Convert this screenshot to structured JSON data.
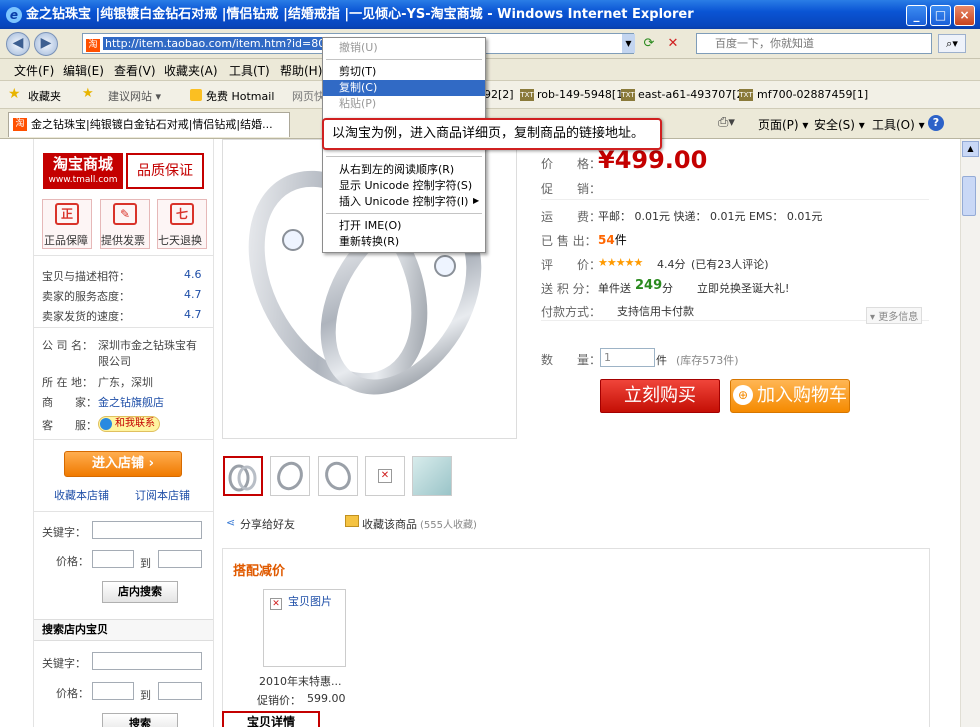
{
  "window": {
    "title": "金之钻珠宝 |纯银镀白金钻石对戒 |情侣钻戒 |结婚戒指 |一见倾心-YS-淘宝商城 - Windows Internet Explorer",
    "ie_glyph": "e"
  },
  "address_bar": {
    "url": "http://item.taobao.com/item.htm?id=80011763",
    "search_placeholder": "百度一下，你就知道"
  },
  "menu": [
    "文件(F)",
    "编辑(E)",
    "查看(V)",
    "收藏夹(A)",
    "工具(T)",
    "帮助(H)"
  ],
  "favorites_bar": {
    "label": "收藏夹",
    "items": [
      "建议网站 ▾",
      "免费 Hotmail",
      "网页快",
      "92[2]",
      "rob-149-5948[1]",
      "east-a61-493707[2]",
      "mf700-02887459[1]"
    ]
  },
  "tab": {
    "label": "金之钻珠宝|纯银镀白金钻石对戒|情侣钻戒|结婚..."
  },
  "command_bar": {
    "page": "页面(P) ▾",
    "safety": "安全(S) ▾",
    "tools": "工具(O) ▾"
  },
  "context_menu": {
    "items": [
      "撤销(U)",
      "剪切(T)",
      "复制(C)",
      "粘贴(P)",
      "从右到左的阅读顺序(R)",
      "显示 Unicode 控制字符(S)",
      "插入 Unicode 控制字符(I)",
      "打开 IME(O)",
      "重新转换(R)"
    ]
  },
  "callout": {
    "text": "以淘宝为例，进入商品详细页，复制商品的链接地址。"
  },
  "shop": {
    "tmall_logo": "淘宝商城",
    "tmall_sub": "www.tmall.com",
    "quality_badge": "品质保证",
    "services": [
      {
        "icon": "正",
        "label": "正品保障"
      },
      {
        "icon": "✎",
        "label": "提供发票"
      },
      {
        "icon": "七",
        "label": "七天退换"
      }
    ],
    "ratings": [
      {
        "label": "宝贝与描述相符：",
        "value": "4.6"
      },
      {
        "label": "卖家的服务态度：",
        "value": "4.7"
      },
      {
        "label": "卖家发货的速度：",
        "value": "4.7"
      }
    ],
    "company_label": "公 司 名：",
    "company_value": "深圳市金之钻珠宝有限公司",
    "company_line1": "深圳市金之钻珠宝有",
    "company_line2": "限公司",
    "location_label": "所 在 地：",
    "location_value": "广东，深圳",
    "seller_label": "商　　家：",
    "seller_value": "金之钻旗舰店",
    "cs_label": "客　　服：",
    "cs_value": "和我联系",
    "enter_shop": "进入店铺 ›",
    "fav_shop": "收藏本店铺",
    "sub_shop": "订阅本店铺",
    "keyword_label": "关键字：",
    "price_label": "价格：",
    "to_label": "到",
    "search_btn": "店内搜索",
    "search_section": "搜索店内宝贝",
    "keyword_label2": "关键字：",
    "price_label2": "价格：",
    "to_label2": "到",
    "search_btn2": "搜索"
  },
  "product": {
    "price_label": "价　　格：",
    "price": "¥499.00",
    "promo_label": "促　　销：",
    "shipping_label": "运　　费：",
    "shipping_value": "平邮： 0.01元  快递： 0.01元  EMS： 0.01元",
    "sold_label": "已 售 出：",
    "sold_value": "54",
    "sold_unit": "件",
    "review_label": "评　　价：",
    "stars": "★★★★★",
    "review_score": "4.4分",
    "review_count": "(已有23人评论)",
    "points_label": "送 积 分：",
    "points_prefix": "单件送",
    "points_value": "249",
    "points_unit": "分",
    "points_link": "立即兑换圣诞大礼!",
    "payment_label": "付款方式：",
    "payment_value": "支持信用卡付款",
    "more_info": "▾ 更多信息",
    "qty_label": "数　　量：",
    "qty_value": "1",
    "qty_unit": "件",
    "stock": "(库存573件)",
    "buy_now": "立刻购买",
    "add_cart": "加入购物车",
    "share": "分享给好友",
    "favorite": "收藏该商品",
    "fav_count": "(555人收藏)",
    "combo_title": "搭配减价",
    "combo_img_alt": "宝贝图片",
    "combo_name": "2010年末特惠...",
    "combo_price_label": "促销价：",
    "combo_price": "599.00",
    "details_tab": "宝贝详情"
  },
  "colors": {
    "accent_red": "#c40000",
    "link_blue": "#1f4fa8",
    "title_blue": "#0a54d4"
  }
}
